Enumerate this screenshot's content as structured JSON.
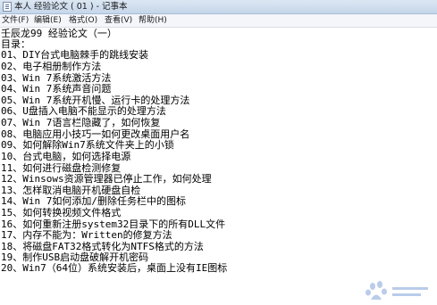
{
  "window": {
    "title": "本人 经验论文 ( 01 ) - 记事本"
  },
  "menu": [
    "文件(F)",
    "编辑(E)",
    "格式(O)",
    "查看(V)",
    "帮助(H)"
  ],
  "document": {
    "lines": [
      "壬辰龙99 经验论文（一）",
      "目录：",
      "01、DIY台式电脑棘手的跳线安装",
      "02、电子相册制作方法",
      "03、Win 7系统激活方法",
      "04、Win 7系统声音问题",
      "05、Win 7系统开机慢、运行卡的处理方法",
      "06、U盘插入电脑不能显示的处理方法",
      "07、Win 7语言栏隐藏了，如何恢复",
      "08、电脑应用小技巧一如何更改桌面用户名",
      "09、如何解除Win7系统文件夹上的小锁",
      "10、台式电脑，如何选择电源",
      "11、如何进行磁盘检测修复",
      "12、Winsows资源管理器已停止工作，如何处理",
      "13、怎样取消电脑开机硬盘自检",
      "14、Win 7如何添加/删除任务栏中的图标",
      "15、如何转换视频文件格式",
      "16、如何重新注册system32目录下的所有DLL文件",
      "17、内存不能为：Written的修复方法",
      "18、将磁盘FAT32格式转化为NTFS格式的方法",
      "19、制作USB启动盘破解开机密码",
      "20、Win7（64位）系统安装后，桌面上没有IE图标"
    ]
  },
  "icons": {
    "app": "notepad-icon",
    "watermark": "baidu-jingyan-watermark"
  }
}
